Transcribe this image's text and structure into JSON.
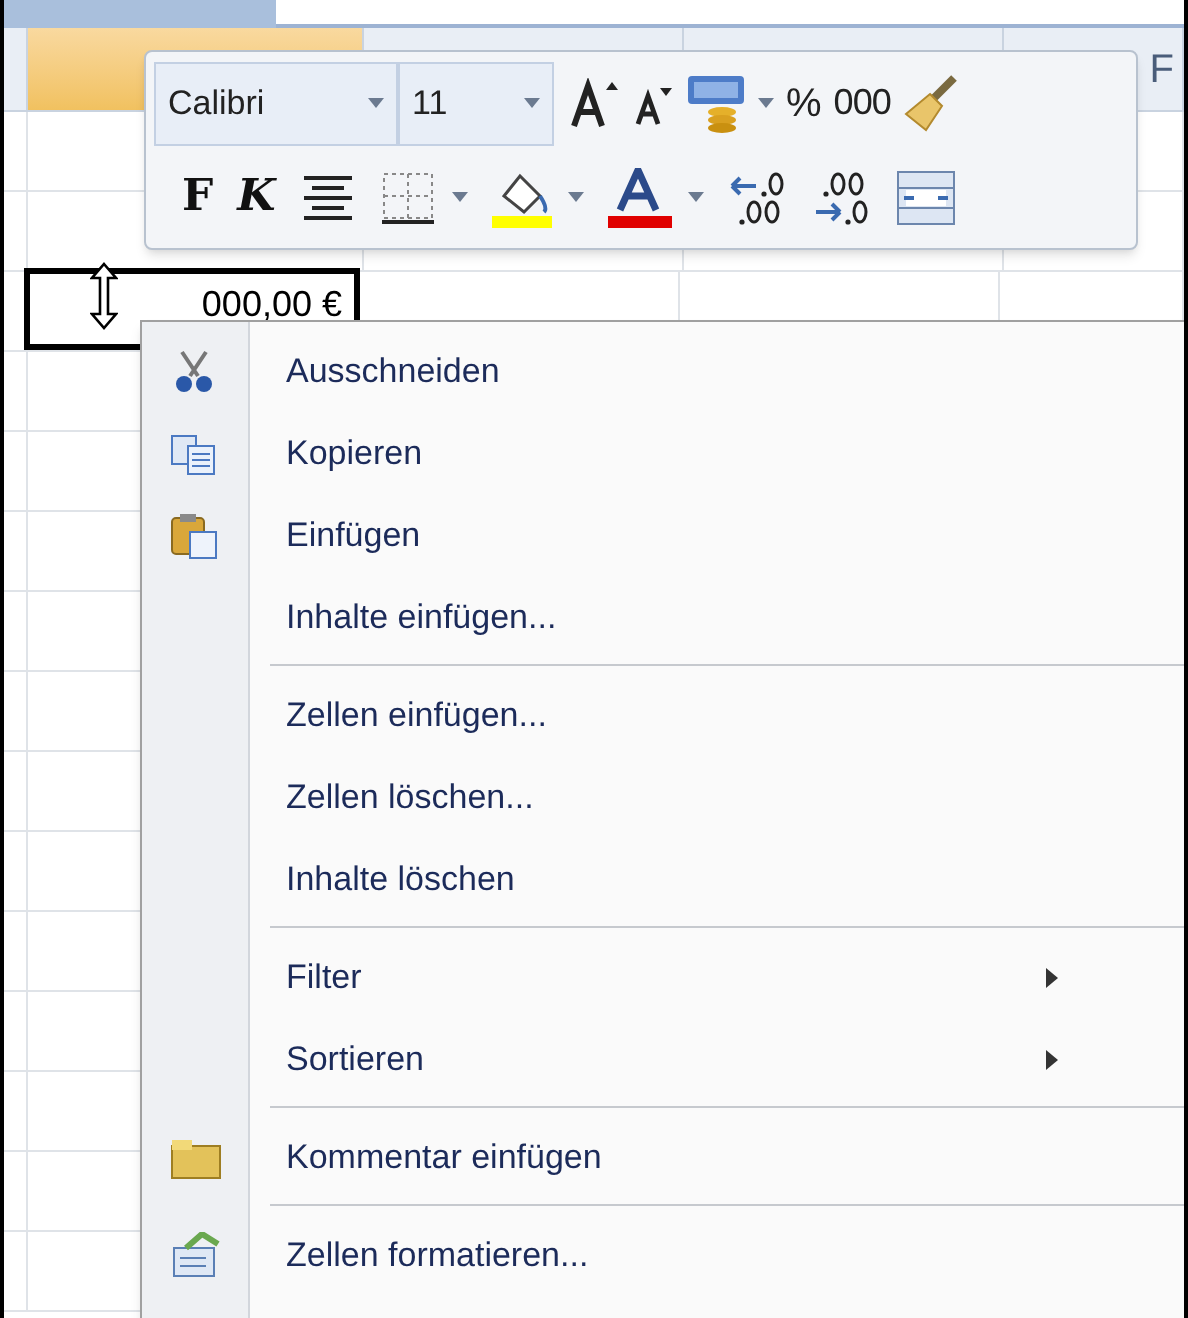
{
  "sheet": {
    "column_headers": [
      {
        "selected": true
      },
      {
        "selected": false
      },
      {
        "selected": false
      },
      {
        "label": "F",
        "selected": false
      }
    ],
    "active_cell": {
      "value": "000,00 €"
    }
  },
  "mini_toolbar": {
    "font": "Calibri",
    "size": "11",
    "percent": "%",
    "thousands": "000",
    "bold": "F",
    "italic": "K"
  },
  "context_menu": [
    {
      "label": "Ausschneiden",
      "separator_before": false,
      "submenu": false
    },
    {
      "label": "Kopieren",
      "separator_before": false,
      "submenu": false
    },
    {
      "label": "Einfügen",
      "separator_before": false,
      "submenu": false
    },
    {
      "label": "Inhalte einfügen...",
      "separator_before": false,
      "submenu": false
    },
    {
      "label": "Zellen einfügen...",
      "separator_before": true,
      "submenu": false
    },
    {
      "label": "Zellen löschen...",
      "separator_before": false,
      "submenu": false
    },
    {
      "label": "Inhalte löschen",
      "separator_before": false,
      "submenu": false
    },
    {
      "label": "Filter",
      "separator_before": true,
      "submenu": true
    },
    {
      "label": "Sortieren",
      "separator_before": false,
      "submenu": true
    },
    {
      "label": "Kommentar einfügen",
      "separator_before": true,
      "submenu": false
    },
    {
      "label": "Zellen formatieren...",
      "separator_before": true,
      "submenu": false
    }
  ]
}
